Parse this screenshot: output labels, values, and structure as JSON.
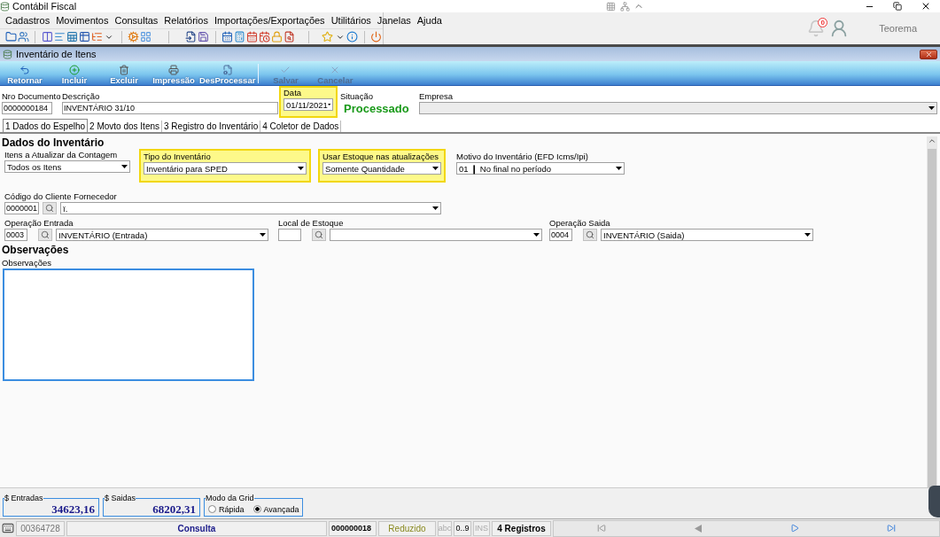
{
  "window": {
    "title": "Contábil Fiscal"
  },
  "menu": [
    "Cadastros",
    "Movimentos",
    "Consultas",
    "Relatórios",
    "Importações/Exportações",
    "Utilitários",
    "Janelas",
    "Ajuda"
  ],
  "notifications": {
    "count": "0"
  },
  "user": {
    "name": "Teorema"
  },
  "form": {
    "title": "Inventário de Itens"
  },
  "actions": [
    {
      "kind": "back",
      "label": "Retornar",
      "disabled": false
    },
    {
      "kind": "add",
      "label": "Incluir",
      "disabled": false
    },
    {
      "kind": "delete",
      "label": "Excluir",
      "disabled": false
    },
    {
      "kind": "print",
      "label": "Impressão",
      "disabled": false
    },
    {
      "kind": "unprocess",
      "label": "DesProcessar",
      "disabled": false
    },
    {
      "kind": "save",
      "label": "Salvar",
      "disabled": true
    },
    {
      "kind": "cancel",
      "label": "Cancelar",
      "disabled": true
    }
  ],
  "header": {
    "nro_documento": {
      "label": "Nro Documento",
      "value": "0000000184"
    },
    "descricao": {
      "label": "Descrição",
      "value": "INVENTÁRIO 31/10"
    },
    "data": {
      "label": "Data",
      "value": "01/11/2021",
      "highlighted": true
    },
    "situacao": {
      "label": "Situação",
      "value": "Processado"
    },
    "empresa": {
      "label": "Empresa"
    }
  },
  "tabs": [
    {
      "label": "1 Dados do Espelho",
      "selected": true
    },
    {
      "label": "2 Movto dos Itens",
      "selected": false
    },
    {
      "label": "3 Registro do Inventário",
      "selected": false
    },
    {
      "label": "4 Coletor de Dados",
      "selected": false
    }
  ],
  "section_title": "Dados do Inventário",
  "itens_atualizar": {
    "label": "Itens a Atualizar da Contagem",
    "value": "Todos os Itens"
  },
  "tipo_inventario": {
    "label": "Tipo do Inventário",
    "value": "Inventário para SPED",
    "highlighted": true
  },
  "usar_estoque": {
    "label": "Usar Estoque nas atualizações",
    "value": "Somente Quantidade",
    "highlighted": true
  },
  "motivo": {
    "label": "Motivo do Inventário (EFD Icms/Ipi)",
    "value": "01 ❙ No final no período"
  },
  "cliente": {
    "label": "Código do Cliente Fornecedor",
    "code": "0000001",
    "value": "ï."
  },
  "operacao_entrada": {
    "label": "Operação Entrada",
    "code": "0003",
    "value": "INVENTÁRIO (Entrada)"
  },
  "local_estoque": {
    "label": "Local de Estoque"
  },
  "operacao_saida": {
    "label": "Operação Saida",
    "code": "0004",
    "value": "INVENTÁRIO (Saida)"
  },
  "observacoes": {
    "title": "Observações",
    "label": "Observações"
  },
  "totals": [
    {
      "label": "$ Entradas",
      "value": "34623,16"
    },
    {
      "label": "$ Saidas",
      "value": "68202,31"
    }
  ],
  "grid_mode": {
    "label": "Modo da Grid",
    "options": [
      {
        "label": "Rápida",
        "selected": false
      },
      {
        "label": "Avançada",
        "selected": true
      }
    ]
  },
  "status_bar": {
    "code": "00364728",
    "mode": "Consulta",
    "document": "000000018",
    "view": "Reduzido",
    "abc": "abc",
    "digits": "0..9",
    "ins": "INS",
    "records": "4 Registros"
  }
}
